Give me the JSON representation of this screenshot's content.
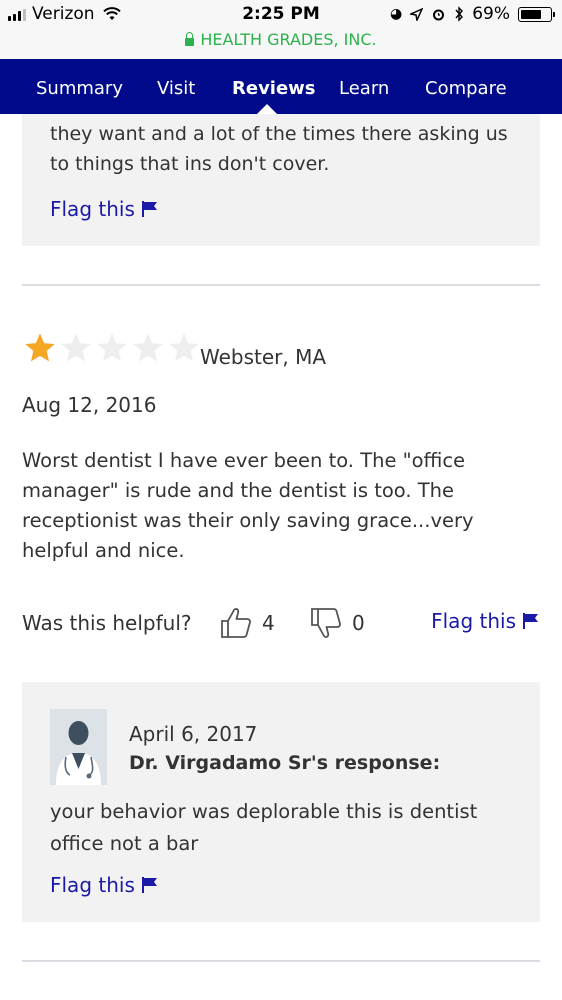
{
  "status_bar": {
    "carrier": "Verizon",
    "time": "2:25 PM",
    "battery": "69%",
    "battery_level": 0.69,
    "icons": [
      "signal-icon",
      "wifi-icon",
      "screen-lock-icon",
      "location-arrow-icon",
      "alarm-icon",
      "bluetooth-icon",
      "battery-icon"
    ]
  },
  "url_bar": {
    "site": "HEALTH GRADES, INC.",
    "secure": true
  },
  "nav": {
    "tabs": [
      {
        "label": "Summary"
      },
      {
        "label": "Visit"
      },
      {
        "label": "Reviews"
      },
      {
        "label": "Learn"
      },
      {
        "label": "Compare"
      }
    ],
    "active": "Reviews"
  },
  "previous_response": {
    "text": "they want and a lot of the times there asking us to things that ins don't cover.",
    "flag_label": "Flag this"
  },
  "review": {
    "rating": 1,
    "max_rating": 5,
    "location": "Webster, MA",
    "date": "Aug 12, 2016",
    "body": "Worst dentist I have ever been to. The \"office manager\" is rude and the dentist is too. The receptionist was their only saving grace...very helpful and nice.",
    "helpful_label": "Was this helpful?",
    "helpful_yes": "4",
    "helpful_no": "0",
    "flag_label": "Flag this"
  },
  "response": {
    "date": "April 6, 2017",
    "name": "Dr. Virgadamo Sr's response:",
    "body": "your behavior was deplorable this is dentist office not a bar",
    "flag_label": "Flag this"
  },
  "colors": {
    "nav_bg": "#000a8a",
    "link": "#1a1aa6",
    "star_filled": "#f5a623",
    "star_empty": "#eeeeee",
    "card_bg": "#f2f2f2",
    "secure_green": "#2bb24c"
  }
}
